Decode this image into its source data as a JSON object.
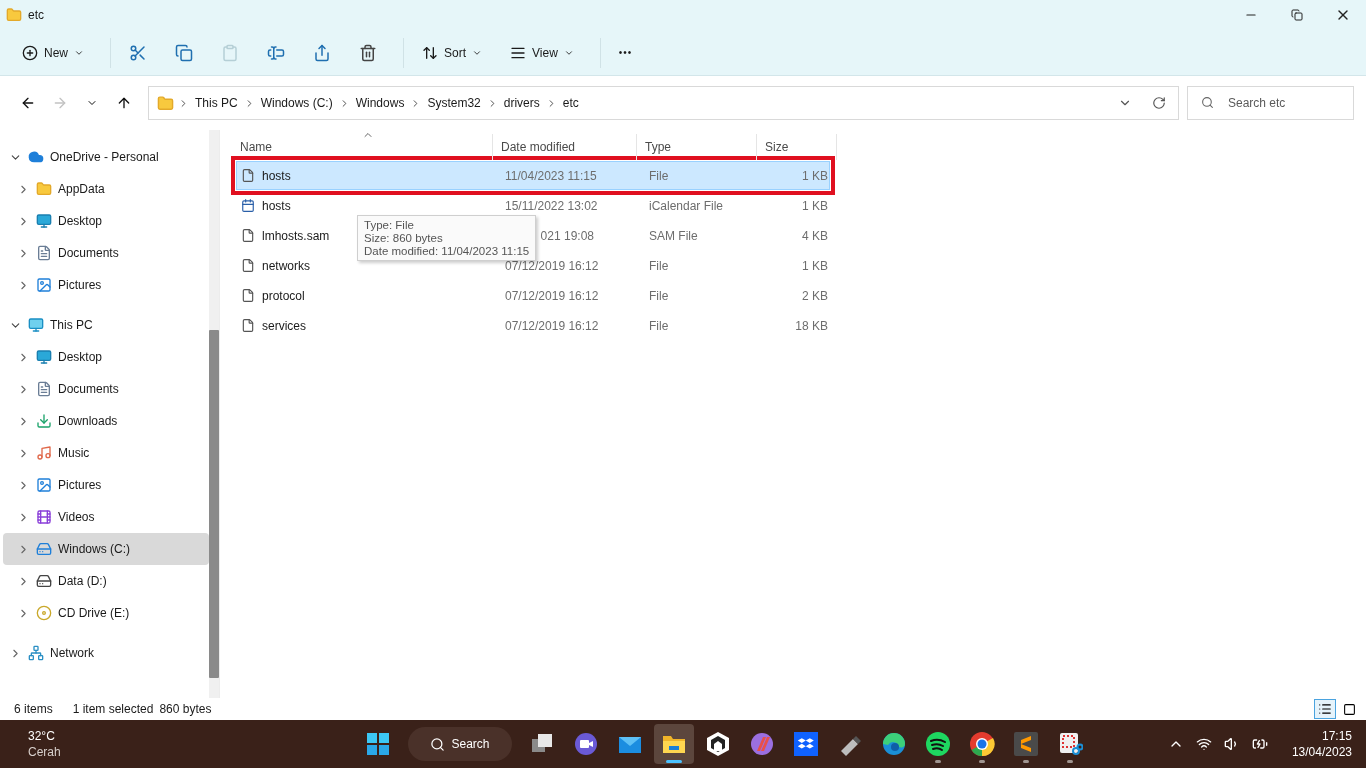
{
  "window": {
    "title": "etc",
    "controls": [
      {
        "kind": "minimize"
      },
      {
        "kind": "restore"
      },
      {
        "kind": "close"
      }
    ]
  },
  "toolbar": {
    "new": {
      "label": "New"
    },
    "actions": [
      {
        "kind": "cut",
        "disabled": false
      },
      {
        "kind": "copy",
        "disabled": false
      },
      {
        "kind": "paste",
        "disabled": true
      },
      {
        "kind": "rename",
        "disabled": false
      },
      {
        "kind": "share",
        "disabled": false
      },
      {
        "kind": "delete",
        "disabled": false
      }
    ],
    "sort": {
      "label": "Sort"
    },
    "view": {
      "label": "View"
    },
    "more": {
      "label": "•••"
    }
  },
  "navigation": [
    {
      "kind": "back",
      "disabled": false
    },
    {
      "kind": "forward",
      "disabled": true
    },
    {
      "kind": "recent",
      "disabled": false
    },
    {
      "kind": "up",
      "disabled": false
    }
  ],
  "address": {
    "breadcrumbs": [
      "This PC",
      "Windows (C:)",
      "Windows",
      "System32",
      "drivers",
      "etc"
    ]
  },
  "search": {
    "placeholder": "Search etc"
  },
  "sidebar": {
    "items": [
      {
        "label": "OneDrive - Personal",
        "kind": "cloud",
        "expanded": true,
        "selected": false,
        "children": [
          {
            "label": "AppData",
            "kind": "folder",
            "expanded": false,
            "selected": false
          },
          {
            "label": "Desktop",
            "kind": "desktop",
            "expanded": false,
            "selected": false
          },
          {
            "label": "Documents",
            "kind": "documents",
            "expanded": false,
            "selected": false
          },
          {
            "label": "Pictures",
            "kind": "pictures",
            "expanded": false,
            "selected": false
          }
        ]
      },
      {
        "label": "This PC",
        "kind": "pc",
        "expanded": true,
        "selected": false,
        "children": [
          {
            "label": "Desktop",
            "kind": "desktop",
            "expanded": false,
            "selected": false
          },
          {
            "label": "Documents",
            "kind": "documents",
            "expanded": false,
            "selected": false
          },
          {
            "label": "Downloads",
            "kind": "downloads",
            "expanded": false,
            "selected": false
          },
          {
            "label": "Music",
            "kind": "music",
            "expanded": false,
            "selected": false
          },
          {
            "label": "Pictures",
            "kind": "pictures",
            "expanded": false,
            "selected": false
          },
          {
            "label": "Videos",
            "kind": "videos",
            "expanded": false,
            "selected": false
          },
          {
            "label": "Windows (C:)",
            "kind": "windrive",
            "expanded": false,
            "selected": true
          },
          {
            "label": "Data (D:)",
            "kind": "drive",
            "expanded": false,
            "selected": false
          },
          {
            "label": "CD Drive (E:)",
            "kind": "cd",
            "expanded": false,
            "selected": false
          }
        ]
      },
      {
        "label": "Network",
        "kind": "network",
        "expanded": false,
        "selected": false
      }
    ]
  },
  "table": {
    "columns": [
      {
        "label": "Name",
        "sorted": true
      },
      {
        "label": "Date modified",
        "sorted": false
      },
      {
        "label": "Type",
        "sorted": false
      },
      {
        "label": "Size",
        "sorted": false
      }
    ],
    "rows": [
      {
        "kind": "file",
        "name": "hosts",
        "date": "11/04/2023 11:15",
        "type": "File",
        "size": "1 KB",
        "selected": true,
        "outlined": true
      },
      {
        "kind": "calendar",
        "name": "hosts",
        "date": "15/11/2022 13:02",
        "type": "iCalendar File",
        "size": "1 KB",
        "selected": false,
        "outlined": false
      },
      {
        "kind": "file",
        "name": "lmhosts.sam",
        "date": "021 19:08",
        "type": "SAM File",
        "size": "4 KB",
        "selected": false,
        "outlined": false
      },
      {
        "kind": "file",
        "name": "networks",
        "date": "07/12/2019 16:12",
        "type": "File",
        "size": "1 KB",
        "selected": false,
        "outlined": false
      },
      {
        "kind": "file",
        "name": "protocol",
        "date": "07/12/2019 16:12",
        "type": "File",
        "size": "2 KB",
        "selected": false,
        "outlined": false
      },
      {
        "kind": "file",
        "name": "services",
        "date": "07/12/2019 16:12",
        "type": "File",
        "size": "18 KB",
        "selected": false,
        "outlined": false
      }
    ]
  },
  "tooltip": {
    "lines": [
      "Type: File",
      "Size: 860 bytes",
      "Date modified: 11/04/2023 11:15"
    ]
  },
  "status_bar": {
    "count": "6 items",
    "selection": "1 item selected",
    "size": "860 bytes",
    "views": [
      {
        "kind": "details",
        "selected": true
      },
      {
        "kind": "large-icons",
        "selected": false
      }
    ]
  },
  "taskbar": {
    "weather": {
      "temperature": "32°C",
      "condition": "Cerah"
    },
    "search": {
      "label": "Search"
    },
    "apps": [
      {
        "kind": "start",
        "running": false,
        "active": false
      },
      {
        "kind": "taskview",
        "running": false,
        "active": false
      },
      {
        "kind": "chat",
        "running": false,
        "active": false
      },
      {
        "kind": "mail",
        "running": false,
        "active": false
      },
      {
        "kind": "explorer",
        "running": true,
        "active": true
      },
      {
        "kind": "hexagon",
        "running": false,
        "active": false
      },
      {
        "kind": "stripes",
        "running": false,
        "active": false
      },
      {
        "kind": "dropbox",
        "running": false,
        "active": false
      },
      {
        "kind": "usb",
        "running": false,
        "active": false
      },
      {
        "kind": "edge",
        "running": false,
        "active": false
      },
      {
        "kind": "spotify",
        "running": true,
        "active": false
      },
      {
        "kind": "chrome",
        "running": true,
        "active": false
      },
      {
        "kind": "sublime",
        "running": true,
        "active": false
      },
      {
        "kind": "snip",
        "running": true,
        "active": false
      }
    ],
    "tray": [
      {
        "kind": "chevron"
      },
      {
        "kind": "wifi"
      },
      {
        "kind": "volume"
      },
      {
        "kind": "battery"
      }
    ],
    "clock": {
      "time": "17:15",
      "date": "13/04/2023"
    }
  }
}
